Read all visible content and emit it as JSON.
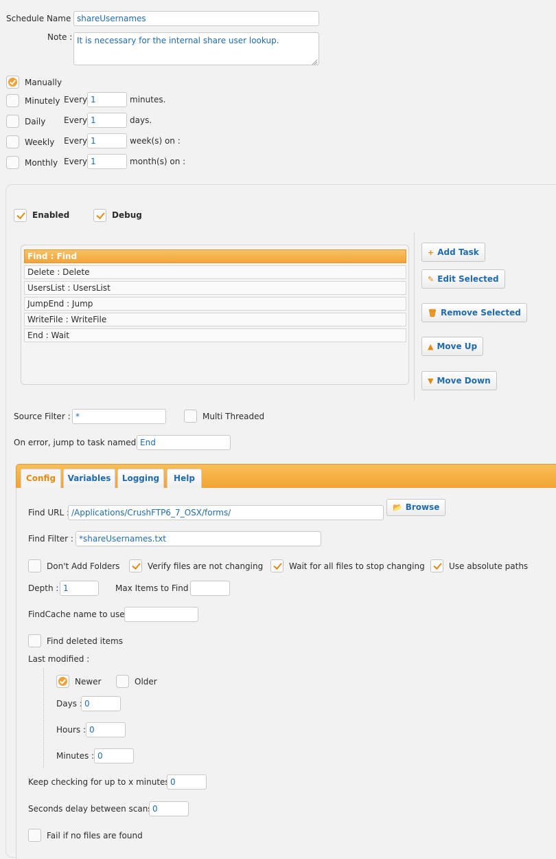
{
  "schedule": {
    "name_label": "Schedule Name :",
    "name_value": "shareUsernames",
    "note_label": "Note :",
    "note_value": "It is necessary for the internal share user lookup."
  },
  "frequency": {
    "manually": "Manually",
    "minutely": "Minutely",
    "daily": "Daily",
    "weekly": "Weekly",
    "monthly": "Monthly",
    "every": "Every",
    "minutely_value": "1",
    "daily_value": "1",
    "weekly_value": "1",
    "monthly_value": "1",
    "minutely_unit": "minutes.",
    "daily_unit": "days.",
    "weekly_unit": "week(s) on :",
    "monthly_unit": "month(s) on :",
    "selected": "Manually"
  },
  "options": {
    "enabled": "Enabled",
    "debug": "Debug"
  },
  "tasks": [
    "Find : Find",
    "Delete : Delete",
    "UsersList : UsersList",
    "JumpEnd : Jump",
    "WriteFile : WriteFile",
    "End : Wait"
  ],
  "buttons": {
    "add_task": "Add Task",
    "edit_selected": "Edit Selected",
    "remove_selected": "Remove Selected",
    "move_up": "Move Up",
    "move_down": "Move Down",
    "browse": "Browse"
  },
  "filters": {
    "source_filter_label": "Source Filter :",
    "source_filter_value": "*",
    "multi_threaded": "Multi Threaded",
    "on_error_label": "On error, jump to task named :",
    "on_error_value": "End"
  },
  "tabs": [
    "Config",
    "Variables",
    "Logging",
    "Help"
  ],
  "config": {
    "find_url_label": "Find URL :",
    "find_url_value": "/Applications/CrushFTP6_7_OSX/forms/",
    "find_filter_label": "Find Filter :",
    "find_filter_value": "*shareUsernames.txt",
    "dont_add_folders": "Don't Add Folders",
    "verify_files": "Verify files are not changing",
    "wait_for_all": "Wait for all files to stop changing",
    "use_absolute": "Use absolute paths",
    "depth_label": "Depth :",
    "depth_value": "1",
    "max_items_label": "Max Items to Find :",
    "max_items_value": "",
    "findcache_label": "FindCache name to use :",
    "findcache_value": "",
    "find_deleted": "Find deleted items",
    "last_modified_label": "Last modified :",
    "newer": "Newer",
    "older": "Older",
    "days_label": "Days :",
    "days_value": "0",
    "hours_label": "Hours :",
    "hours_value": "0",
    "minutes_label": "Minutes :",
    "minutes_value": "0",
    "keep_checking_label": "Keep checking for up to x minutes :",
    "keep_checking_value": "0",
    "seconds_delay_label": "Seconds delay between scans :",
    "seconds_delay_value": "0",
    "fail_if_none": "Fail if no files are found"
  },
  "colors": {
    "accent": "#f3a333",
    "link": "#1f6bb0",
    "background": "#f2f2f2"
  }
}
